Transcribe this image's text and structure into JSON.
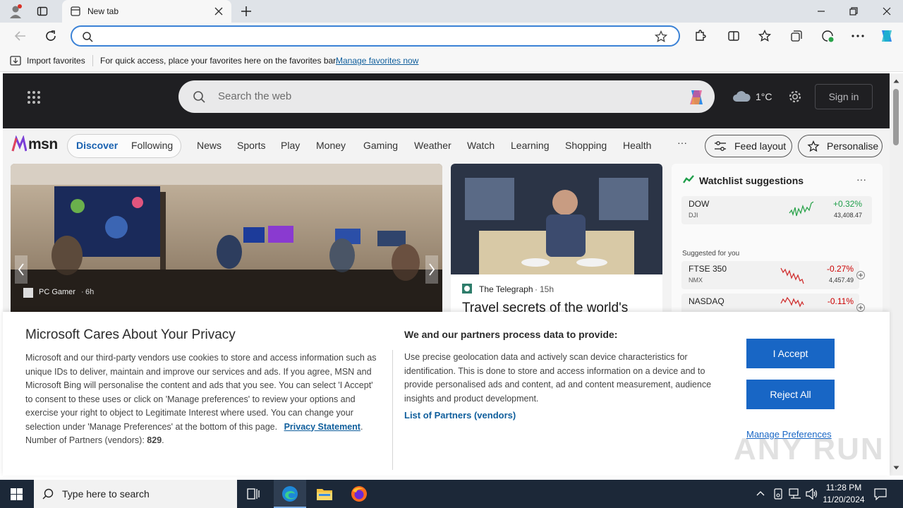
{
  "browser": {
    "tab_title": "New tab",
    "address_value": "",
    "favorites_bar": {
      "import_label": "Import favorites",
      "hint": "For quick access, place your favorites here on the favorites bar.",
      "manage_link": "Manage favorites now"
    }
  },
  "msn": {
    "search_placeholder": "Search the web",
    "temperature": "1°C",
    "signin": "Sign in",
    "logo": "msn",
    "tabs": [
      "Discover",
      "Following"
    ],
    "nav": [
      "News",
      "Sports",
      "Play",
      "Money",
      "Gaming",
      "Weather",
      "Watch",
      "Learning",
      "Shopping",
      "Health"
    ],
    "more": "···",
    "feed_layout": "Feed layout",
    "personalise": "Personalise",
    "hero": {
      "source": "PC Gamer",
      "age": "6h"
    },
    "card2": {
      "source": "The Telegraph",
      "age": "15h",
      "headline": "Travel secrets of the world's"
    },
    "watchlist": {
      "title": "Watchlist suggestions",
      "menu": "···",
      "suggested_label": "Suggested for you",
      "stocks": [
        {
          "symbol": "DOW",
          "sub": "DJI",
          "change": "+0.32%",
          "price": "43,408.47",
          "up": true
        },
        {
          "symbol": "FTSE 350",
          "sub": "NMX",
          "change": "-0.27%",
          "price": "4,457.49",
          "up": false
        },
        {
          "symbol": "NASDAQ",
          "sub": "",
          "change": "-0.11%",
          "price": "",
          "up": false
        }
      ]
    }
  },
  "privacy": {
    "title": "Microsoft Cares About Your Privacy",
    "body": "Microsoft and our third-party vendors use cookies to store and access information such as unique IDs to deliver, maintain and improve our services and ads. If you agree, MSN and Microsoft Bing will personalise the content and ads that you see. You can select 'I Accept' to consent to these uses or click on 'Manage preferences' to review your options and exercise your right to object to Legitimate Interest where used.  You can change your selection under 'Manage Preferences' at the bottom of this page.",
    "privacy_link": "Privacy Statement",
    "partners_label": "Number of Partners (vendors):",
    "partners_count": "829",
    "heading2": "We and our partners process data to provide:",
    "body2": "Use precise geolocation data and actively scan device characteristics for identification. This is done to store and access information on a device and to provide personalised ads and content, ad and content measurement, audience insights and product development.",
    "partners_link": "List of Partners (vendors)",
    "accept": "I Accept",
    "reject": "Reject All",
    "manage": "Manage Preferences"
  },
  "watermark": "ANY RUN",
  "taskbar": {
    "search_placeholder": "Type here to search",
    "time": "11:28 PM",
    "date": "11/20/2024"
  },
  "colors": {
    "accent": "#1866c5",
    "link": "#0f5e9c",
    "taskbar": "#1c2838"
  }
}
